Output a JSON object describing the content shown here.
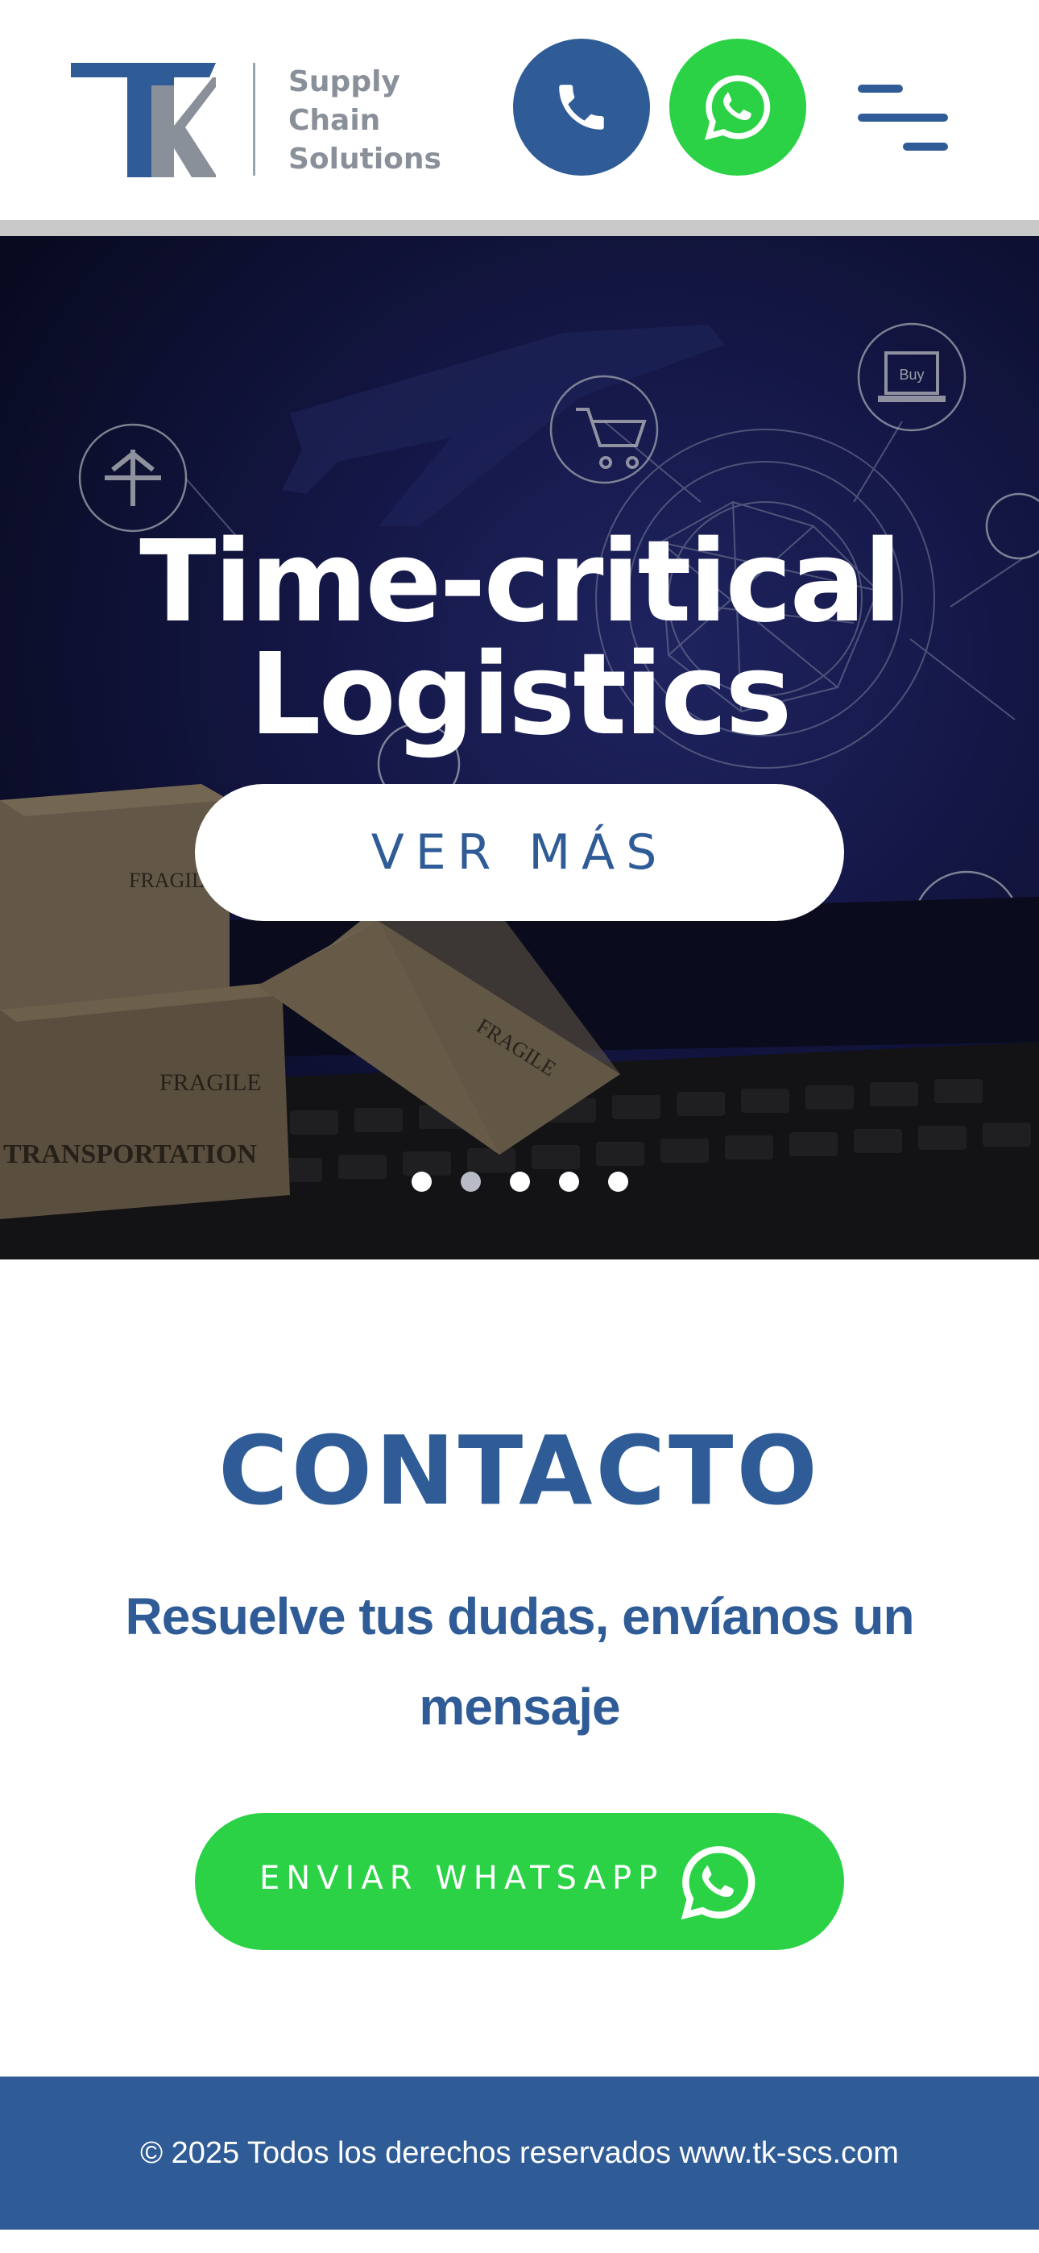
{
  "header": {
    "logo_letters": "TK",
    "logo_text": [
      "Supply",
      "Chain",
      "Solutions"
    ],
    "phone_icon": "phone-icon",
    "whatsapp_icon": "whatsapp-icon",
    "menu_icon": "hamburger-menu-icon"
  },
  "hero": {
    "title_line1": "Time-critical",
    "title_line2": "Logistics",
    "cta_label": "VER MÁS",
    "slide_count": 5,
    "active_slide": 1,
    "scene_labels": [
      "Buy",
      "FRAGILE",
      "FRAGILE",
      "FRAGILE",
      "TRANSPORTATION"
    ]
  },
  "contact": {
    "title": "CONTACTO",
    "subtitle": "Resuelve tus dudas, envíanos un mensaje",
    "button_label": "ENVIAR WHATSAPP"
  },
  "footer": {
    "text": "© 2025 Todos los derechos reservados www.tk-scs.com"
  },
  "colors": {
    "brand_blue": "#2f5c96",
    "whatsapp_green": "#2bd246",
    "logo_gray": "#8a909a",
    "hero_dark": "#10133a"
  }
}
